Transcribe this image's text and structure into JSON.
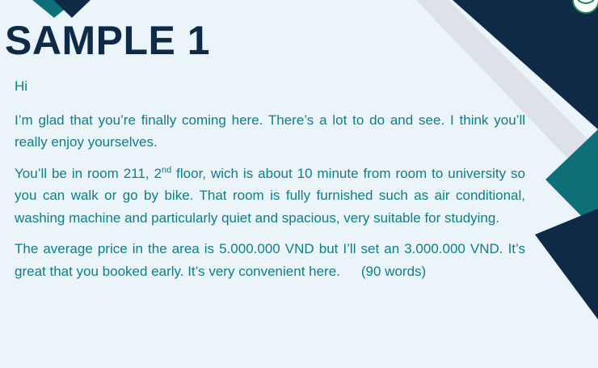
{
  "title": "SAMPLE 1",
  "letter": {
    "greeting": "Hi",
    "paragraph1": "I’m glad that you’re finally coming here. There’s a lot to do and see. I think you’ll really enjoy yourselves.",
    "paragraph2": {
      "before_sup": "You’ll be in room 211, 2",
      "sup": "nd",
      "after_sup": " floor, wich is about 10 minute from room to university so you can walk or go by bike. That room is fully furnished such as air conditional, washing machine and particularly quiet and spacious, very suitable for studying."
    },
    "paragraph3": "The average price in the area is 5.000.000 VND but I’ll set an 3.000.000 VND. It’s great that you booked early. It’s very convenient here.",
    "word_count": "(90 words)"
  },
  "colors": {
    "background": "#eaf4f9",
    "title": "#0e2a47",
    "body_text": "#107d88",
    "navy": "#0e2a47",
    "teal": "#0f6f78",
    "light_gray": "#dde2e8"
  },
  "icons": [
    "logo-icon"
  ]
}
